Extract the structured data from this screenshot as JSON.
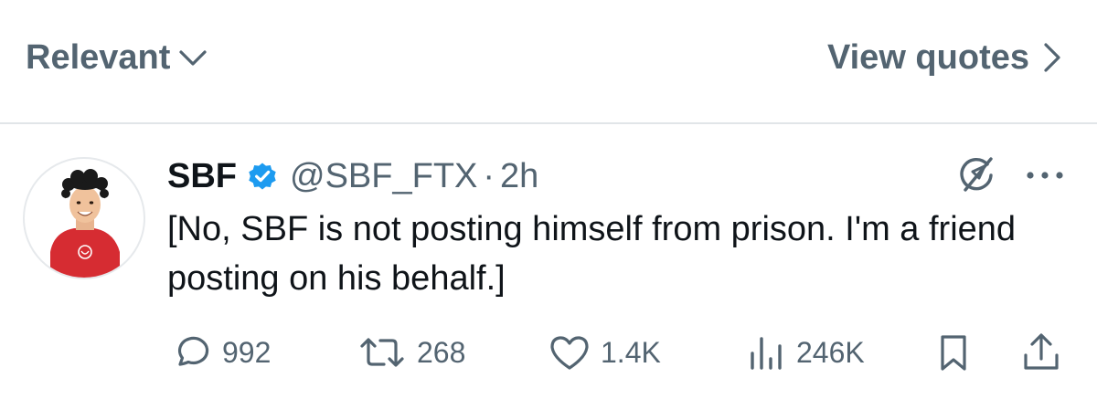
{
  "topbar": {
    "sort_label": "Relevant",
    "view_quotes_label": "View quotes"
  },
  "tweet": {
    "author_name": "SBF",
    "author_handle": "@SBF_FTX",
    "separator": "·",
    "timestamp": "2h",
    "verified": true,
    "text": "[No, SBF is not posting himself from prison. I'm a friend posting on his behalf.]"
  },
  "actions": {
    "replies": "992",
    "reposts": "268",
    "likes": "1.4K",
    "views": "246K"
  },
  "colors": {
    "secondary_text": "#536471",
    "primary_text": "#0f1419",
    "verified_blue": "#1d9bf0",
    "avatar_shirt": "#d62c32"
  },
  "icons": [
    "chevron-down-icon",
    "chevron-right-icon",
    "verified-badge-icon",
    "grok-icon",
    "more-icon",
    "reply-icon",
    "repost-icon",
    "like-icon",
    "views-icon",
    "bookmark-icon",
    "share-icon"
  ]
}
